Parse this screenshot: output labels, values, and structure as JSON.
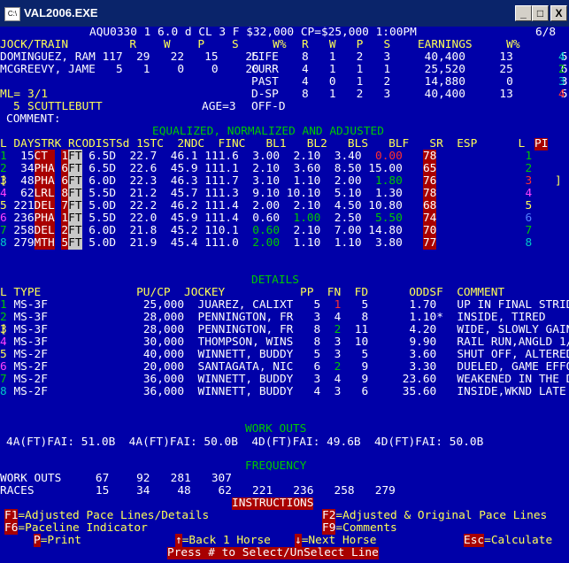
{
  "window": {
    "title": "VAL2006.EXE",
    "icon_text": "C:\\",
    "minimize": "_",
    "maximize": "□",
    "close": "X"
  },
  "race_info": {
    "header": "AQU0330 1 6.0 d CL 3 F $32,000 CP=$25,000 1:00PM",
    "page": "6/8"
  },
  "jock_train": {
    "h1": "JOCK/TRAIN         R    W    P    S     W%",
    "h2": "R   W   P   S    EARNINGS     W%         EPS  R",
    "row1": "DOMINGUEZ, RAM 117  29   22   15    25",
    "row2": "MCGREEVY, JAME   5   1    0    0    20",
    "l1": "LIFE",
    "l2": "CURR",
    "l3": "PAST",
    "l4": "D-SP",
    "s1": "8   1   2   3     40,400     13       5,050",
    "s2": "4   1   1   1     25,520     25       6,380",
    "s3": "4   0   1   2     14,880      0       3,720",
    "s4": "8   1   2   3     40,400     13       5,050",
    "r1": "4",
    "r2": "2",
    "r3": "3",
    "r4": "4"
  },
  "horse": {
    "ml_label": "ML=",
    "ml": "3/1",
    "num": "5",
    "name": "SCUTTLEBUTT",
    "age": "AGE=3",
    "offd": "OFF-D",
    "comment": "COMMENT:"
  },
  "equalized": {
    "title": "EQUALIZED, NORMALIZED AND ADJUSTED",
    "head": "L DAYSTRK RCODISTSd 1STC  2NDC  FINC   BL1   BL2   BLS   BLF   SR  ESP      L",
    "pi": "PI",
    "rows": [
      {
        "l": "1",
        "days": "  15",
        "trk": "CT ",
        "rc": "1",
        "ft": "FT",
        "dist": " 6.5D",
        "c1": "22.7",
        "c2": "46.1",
        "fin": "111.6",
        "bl1": " 3.00",
        "bl2": " 2.10",
        "bls": " 3.40",
        "blf": " 0.00",
        "sr": "78",
        "lr": "1"
      },
      {
        "l": "2",
        "days": "  34",
        "trk": "PHA",
        "rc": "6",
        "ft": "FT",
        "dist": " 6.5D",
        "c1": "22.6",
        "c2": "45.9",
        "fin": "111.1",
        "bl1": " 2.10",
        "bl2": " 3.60",
        "bls": " 8.50",
        "blf": "15.00",
        "sr": "65",
        "lr": "2"
      },
      {
        "l": "3",
        "days": "  48",
        "trk": "PHA",
        "rc": "6",
        "ft": "FT",
        "dist": " 6.0D",
        "c1": "22.3",
        "c2": "46.3",
        "fin": "111.7",
        "bl1": " 3.10",
        "bl2": " 1.10",
        "bls": " 2.00",
        "blf": " 1.80",
        "sr": "76",
        "lr": "3"
      },
      {
        "l": "4",
        "days": "  62",
        "trk": "LRL",
        "rc": "8",
        "ft": "FT",
        "dist": " 5.5D",
        "c1": "21.2",
        "c2": "45.7",
        "fin": "111.3",
        "bl1": " 9.10",
        "bl2": "10.10",
        "bls": " 5.10",
        "blf": " 1.30",
        "sr": "78",
        "lr": "4"
      },
      {
        "l": "5",
        "days": " 221",
        "trk": "DEL",
        "rc": "7",
        "ft": "FT",
        "dist": " 5.0D",
        "c1": "22.2",
        "c2": "46.2",
        "fin": "111.4",
        "bl1": " 2.00",
        "bl2": " 2.10",
        "bls": " 4.50",
        "blf": "10.80",
        "sr": "68",
        "lr": "5"
      },
      {
        "l": "6",
        "days": " 236",
        "trk": "PHA",
        "rc": "1",
        "ft": "FT",
        "dist": " 5.5D",
        "c1": "22.0",
        "c2": "45.9",
        "fin": "111.4",
        "bl1": " 0.60",
        "bl2": " 1.00",
        "bls": " 2.50",
        "blf": " 5.50",
        "sr": "74",
        "lr": "6"
      },
      {
        "l": "7",
        "days": " 258",
        "trk": "DEL",
        "rc": "2",
        "ft": "FT",
        "dist": " 6.0D",
        "c1": "21.8",
        "c2": "45.2",
        "fin": "110.1",
        "bl1": " 0.60",
        "bl2": " 2.10",
        "bls": " 7.00",
        "blf": "14.80",
        "sr": "70",
        "lr": "7"
      },
      {
        "l": "8",
        "days": " 279",
        "trk": "MTH",
        "rc": "5",
        "ft": "FT",
        "dist": " 5.0D",
        "c1": "21.9",
        "c2": "45.4",
        "fin": "111.0",
        "bl1": " 2.00",
        "bl2": " 1.10",
        "bls": " 1.10",
        "blf": " 3.80",
        "sr": "77",
        "lr": "8"
      }
    ]
  },
  "details": {
    "title": "DETAILS",
    "head": "L TYPE              PU/CP  JOCKEY           PP  FN  FD      ODDSF  COMMENT",
    "rows": [
      {
        "l": "1",
        "type": "MS-3F",
        "pu": "25,000",
        "jockey": "JUAREZ, CALIXT  ",
        "pp": "5",
        "fn": "1",
        "fd": " 5",
        "odds": " 1.70 ",
        "comment": "UP IN FINAL STRIDES"
      },
      {
        "l": "2",
        "type": "MS-3F",
        "pu": "28,000",
        "jockey": "PENNINGTON, FR  ",
        "pp": "3",
        "fn": "4",
        "fd": " 8",
        "odds": " 1.10*",
        "comment": "INSIDE, TIRED"
      },
      {
        "l": "3",
        "type": "MS-3F",
        "pu": "28,000",
        "jockey": "PENNINGTON, FR  ",
        "pp": "8",
        "fn": "2",
        "fd": "11",
        "odds": " 4.20 ",
        "comment": "WIDE, SLOWLY GAINING"
      },
      {
        "l": "4",
        "type": "MS-3F",
        "pu": "30,000",
        "jockey": "THOMPSON, WINS  ",
        "pp": "8",
        "fn": "3",
        "fd": "10",
        "odds": " 9.90 ",
        "comment": "RAIL RUN,ANGLD 1/8,GME"
      },
      {
        "l": "5",
        "type": "MS-2F",
        "pu": "40,000",
        "jockey": "WINNETT, BUDDY  ",
        "pp": "5",
        "fn": "3",
        "fd": " 5",
        "odds": " 3.60 ",
        "comment": "SHUT OFF, ALTERED C"
      },
      {
        "l": "6",
        "type": "MS-2F",
        "pu": "20,000",
        "jockey": "SANTAGATA, NIC  ",
        "pp": "6",
        "fn": "2",
        "fd": " 9",
        "odds": " 3.30 ",
        "comment": "DUELED, GAME EFFORT"
      },
      {
        "l": "7",
        "type": "MS-2F",
        "pu": "36,000",
        "jockey": "WINNETT, BUDDY  ",
        "pp": "3",
        "fn": "4",
        "fd": " 9",
        "odds": "23.60 ",
        "comment": "WEAKENED IN THE DRIVE"
      },
      {
        "l": "8",
        "type": "MS-2F",
        "pu": "36,000",
        "jockey": "WINNETT, BUDDY  ",
        "pp": "4",
        "fn": "3",
        "fd": " 6",
        "odds": "35.60 ",
        "comment": "INSIDE,WKND LATE"
      }
    ]
  },
  "workouts": {
    "title": "WORK OUTS",
    "line": "4A(FT)FAI: 51.0B  4A(FT)FAI: 50.0B  4D(FT)FAI: 49.6B  4D(FT)FAI: 50.0B"
  },
  "frequency": {
    "title": "FREQUENCY",
    "wo": "WORK OUTS     67    92   281   307",
    "races": "RACES         15    34    48    62   221   236   258   279"
  },
  "instructions": {
    "title": "INSTRUCTIONS",
    "f1k": "F1",
    "f1": "=Adjusted Pace Lines/Details",
    "f2k": "F2",
    "f2": "=Adjusted & Original Pace Lines",
    "f6k": "F6",
    "f6": "=Paceline Indicator",
    "f9k": "F9",
    "f9": "=Comments",
    "pk": "P",
    "p": "=Print",
    "upk": "↑",
    "up": "=Back 1 Horse",
    "dnk": "↓",
    "dn": "=Next Horse",
    "esck": "Esc",
    "esc": "=Calculate",
    "select": "Press # to Select/UnSelect Line"
  }
}
